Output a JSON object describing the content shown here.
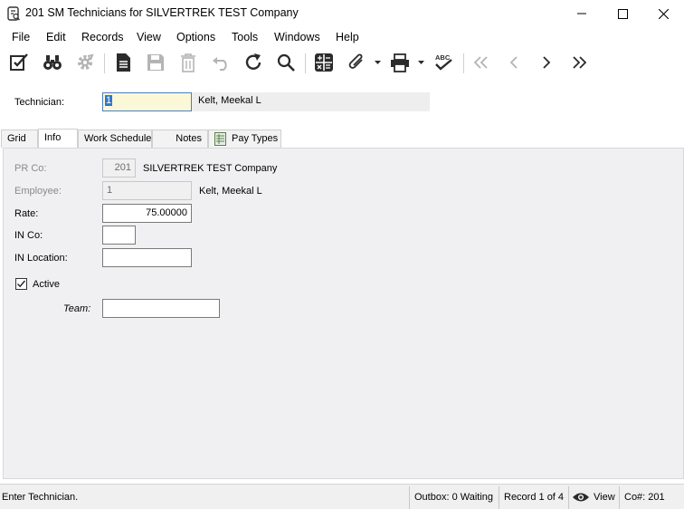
{
  "window": {
    "title": "201 SM Technicians for SILVERTREK TEST Company"
  },
  "menu": {
    "items": [
      "File",
      "Edit",
      "Records",
      "View",
      "Options",
      "Tools",
      "Windows",
      "Help"
    ]
  },
  "toolbar": {
    "buttons": [
      "edit-check-icon",
      "binoculars-icon",
      "gear-icon",
      "new-document-icon",
      "save-icon",
      "delete-icon",
      "undo-icon",
      "refresh-icon",
      "search-icon",
      "calculator-icon",
      "attachment-icon",
      "print-icon",
      "spellcheck-icon",
      "first-record-icon",
      "previous-record-icon",
      "next-record-icon",
      "last-record-icon"
    ],
    "spellcheck_text": "ABC"
  },
  "header": {
    "technician_label": "Technician:",
    "technician_value": "1",
    "technician_name": "Kelt, Meekal L"
  },
  "tabs": {
    "items": [
      "Grid",
      "Info",
      "Work Schedule",
      "Notes",
      "Pay Types"
    ],
    "active": "Info"
  },
  "info": {
    "prco_label": "PR Co:",
    "prco_value": "201",
    "prco_desc": "SILVERTREK TEST Company",
    "employee_label": "Employee:",
    "employee_value": "1",
    "employee_desc": "Kelt, Meekal L",
    "rate_label": "Rate:",
    "rate_value": "75.00000",
    "inco_label": "IN Co:",
    "inco_value": "",
    "inlocation_label": "IN Location:",
    "inlocation_value": "",
    "active_label": "Active",
    "active_checked": true,
    "team_label": "Team:",
    "team_value": ""
  },
  "status": {
    "message": "Enter Technician.",
    "outbox": "Outbox: 0 Waiting",
    "record": "Record 1 of 4",
    "view": "View",
    "company": "Co#: 201"
  },
  "colors": {
    "accent": "#3377cc",
    "required_field": "#fbf8d8",
    "panel_bg": "#f0f0f3"
  }
}
